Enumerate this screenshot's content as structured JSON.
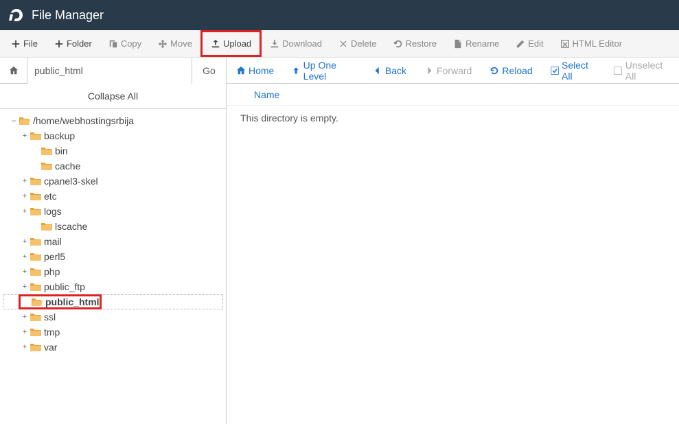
{
  "header": {
    "title": "File Manager"
  },
  "toolbar": [
    {
      "id": "file",
      "label": "File",
      "icon": "plus",
      "active": true
    },
    {
      "id": "folder",
      "label": "Folder",
      "icon": "plus",
      "active": true
    },
    {
      "id": "copy",
      "label": "Copy",
      "icon": "copy",
      "active": false
    },
    {
      "id": "move",
      "label": "Move",
      "icon": "arrows",
      "active": false
    },
    {
      "id": "upload",
      "label": "Upload",
      "icon": "upload",
      "active": true,
      "highlighted": true
    },
    {
      "id": "download",
      "label": "Download",
      "icon": "download",
      "active": false
    },
    {
      "id": "delete",
      "label": "Delete",
      "icon": "close",
      "active": false
    },
    {
      "id": "restore",
      "label": "Restore",
      "icon": "undo",
      "active": false
    },
    {
      "id": "rename",
      "label": "Rename",
      "icon": "file",
      "active": false
    },
    {
      "id": "edit",
      "label": "Edit",
      "icon": "pencil",
      "active": false
    },
    {
      "id": "htmleditor",
      "label": "HTML Editor",
      "icon": "edit-square",
      "active": false
    }
  ],
  "sidebar": {
    "path_value": "public_html",
    "go_label": "Go",
    "collapse_label": "Collapse All",
    "tree": [
      {
        "depth": 0,
        "expander": "–",
        "open": true,
        "label": "/home/webhostingsrbija"
      },
      {
        "depth": 1,
        "expander": "+",
        "open": false,
        "label": "backup"
      },
      {
        "depth": 2,
        "expander": "",
        "open": false,
        "label": "bin"
      },
      {
        "depth": 2,
        "expander": "",
        "open": false,
        "label": "cache"
      },
      {
        "depth": 1,
        "expander": "+",
        "open": false,
        "label": "cpanel3-skel"
      },
      {
        "depth": 1,
        "expander": "+",
        "open": false,
        "label": "etc"
      },
      {
        "depth": 1,
        "expander": "+",
        "open": false,
        "label": "logs"
      },
      {
        "depth": 2,
        "expander": "",
        "open": false,
        "label": "lscache"
      },
      {
        "depth": 1,
        "expander": "+",
        "open": false,
        "label": "mail"
      },
      {
        "depth": 1,
        "expander": "+",
        "open": false,
        "label": "perl5"
      },
      {
        "depth": 1,
        "expander": "+",
        "open": false,
        "label": "php"
      },
      {
        "depth": 1,
        "expander": "+",
        "open": false,
        "label": "public_ftp"
      },
      {
        "depth": 1,
        "expander": "",
        "open": true,
        "label": "public_html",
        "selected": true,
        "highlighted": true
      },
      {
        "depth": 1,
        "expander": "+",
        "open": false,
        "label": "ssl"
      },
      {
        "depth": 1,
        "expander": "+",
        "open": false,
        "label": "tmp"
      },
      {
        "depth": 1,
        "expander": "+",
        "open": false,
        "label": "var"
      }
    ]
  },
  "nav": [
    {
      "id": "home",
      "label": "Home",
      "icon": "house",
      "disabled": false
    },
    {
      "id": "up",
      "label": "Up One Level",
      "icon": "up",
      "disabled": false
    },
    {
      "id": "back",
      "label": "Back",
      "icon": "left",
      "disabled": false
    },
    {
      "id": "forward",
      "label": "Forward",
      "icon": "right",
      "disabled": true
    },
    {
      "id": "reload",
      "label": "Reload",
      "icon": "reload",
      "disabled": false
    },
    {
      "id": "selectall",
      "label": "Select All",
      "icon": "check",
      "disabled": false
    },
    {
      "id": "unselectall",
      "label": "Unselect All",
      "icon": "uncheck",
      "disabled": true
    }
  ],
  "columns": {
    "name": "Name"
  },
  "empty_message": "This directory is empty."
}
